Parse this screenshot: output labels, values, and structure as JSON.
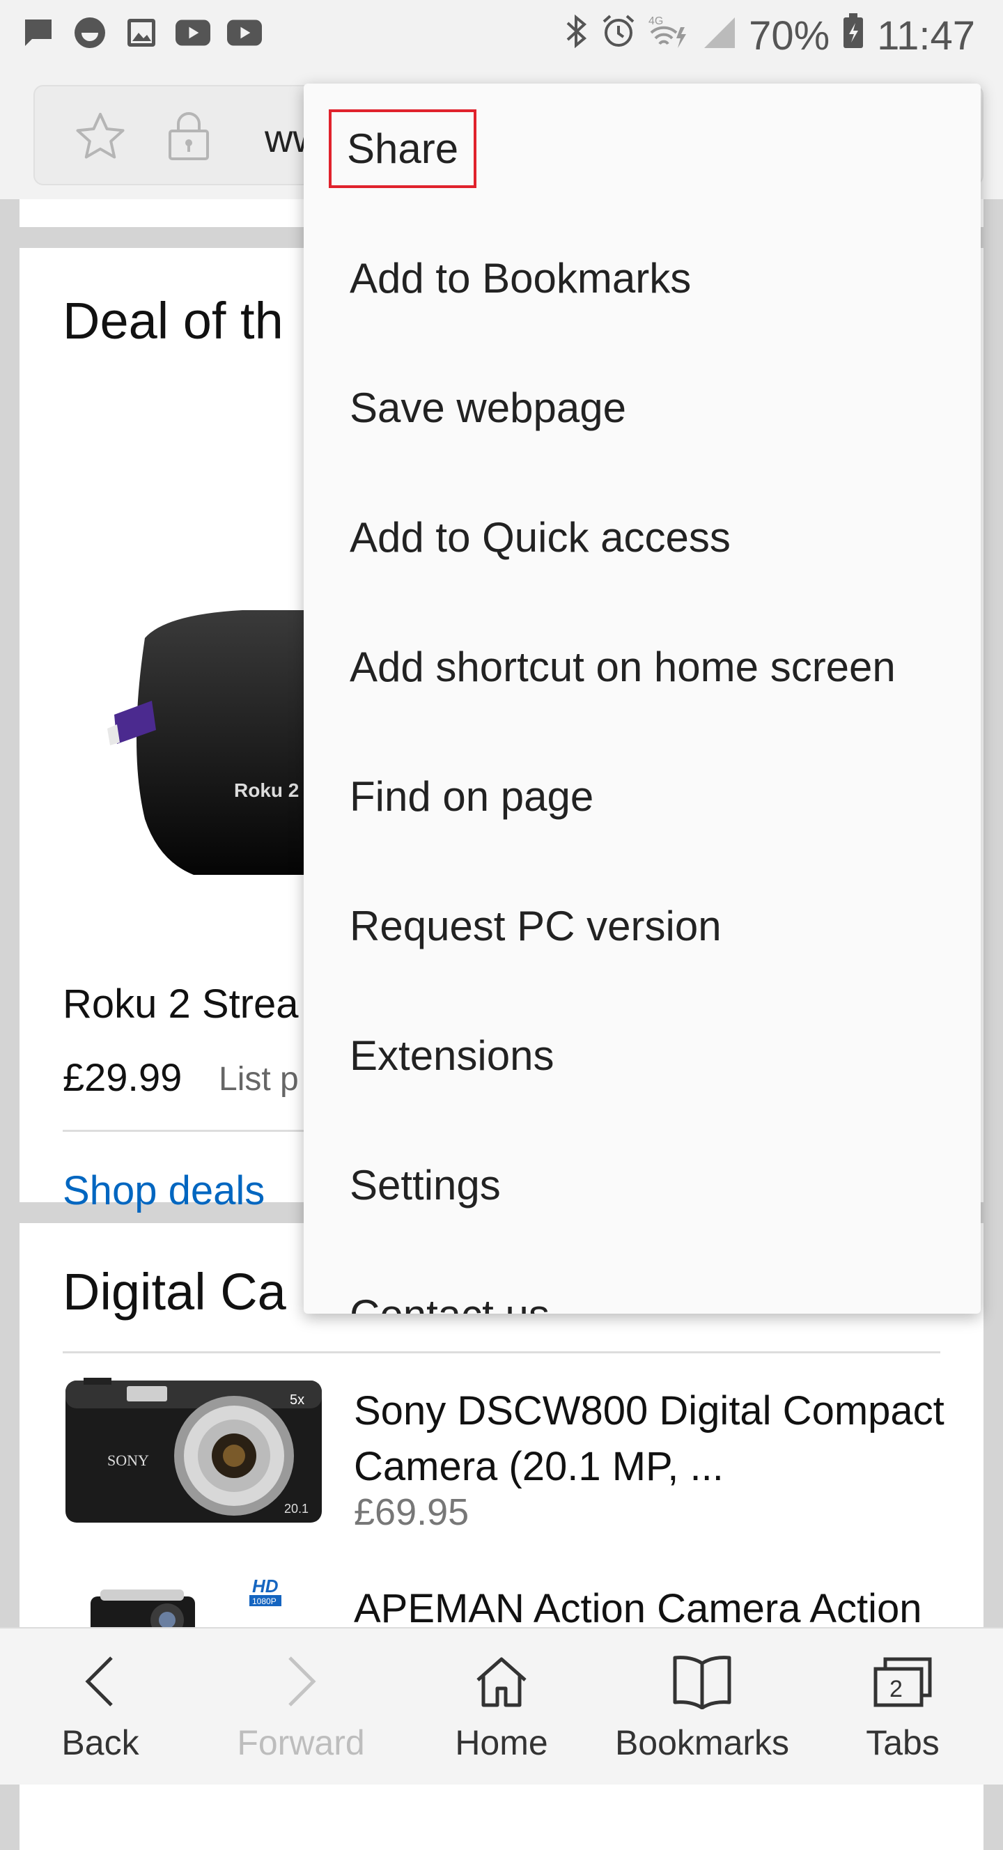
{
  "status_bar": {
    "left_icons": [
      "message-icon",
      "smiley-app-icon",
      "gallery-icon",
      "youtube-icon",
      "youtube-icon"
    ],
    "right_icons": [
      "bluetooth-icon",
      "alarm-icon",
      "wifi-4g-icon",
      "signal-icon",
      "battery-icon"
    ],
    "battery": "70%",
    "time": "11:47"
  },
  "address_bar": {
    "url_text": "ww"
  },
  "deal_card": {
    "title": "Deal of th",
    "product_name": "Roku 2 Strea",
    "price": "£29.99",
    "list_price": "List p",
    "shop_deals": "Shop deals",
    "product_logo": "Roku 2"
  },
  "cameras_card": {
    "title": "Digital Ca",
    "items": [
      {
        "name": "Sony DSCW800 Digital Compact Camera (20.1 MP, ...",
        "price": "£69.95"
      },
      {
        "name": "APEMAN Action Camera Action",
        "price": ""
      }
    ]
  },
  "menu": {
    "items": [
      {
        "label": "Share"
      },
      {
        "label": "Add to Bookmarks"
      },
      {
        "label": "Save webpage"
      },
      {
        "label": "Add to Quick access"
      },
      {
        "label": "Add shortcut on home screen"
      },
      {
        "label": "Find on page"
      },
      {
        "label": "Request PC version"
      },
      {
        "label": "Extensions"
      },
      {
        "label": "Settings"
      },
      {
        "label": "Contact us"
      }
    ],
    "highlight_color": "#e0222c"
  },
  "bottom_nav": {
    "back": "Back",
    "forward": "Forward",
    "home": "Home",
    "bookmarks": "Bookmarks",
    "tabs": "Tabs",
    "tab_count": "2"
  },
  "colors": {
    "link": "#0066c0",
    "page_bg": "#d4d4d4",
    "menu_bg": "#fafafa"
  }
}
